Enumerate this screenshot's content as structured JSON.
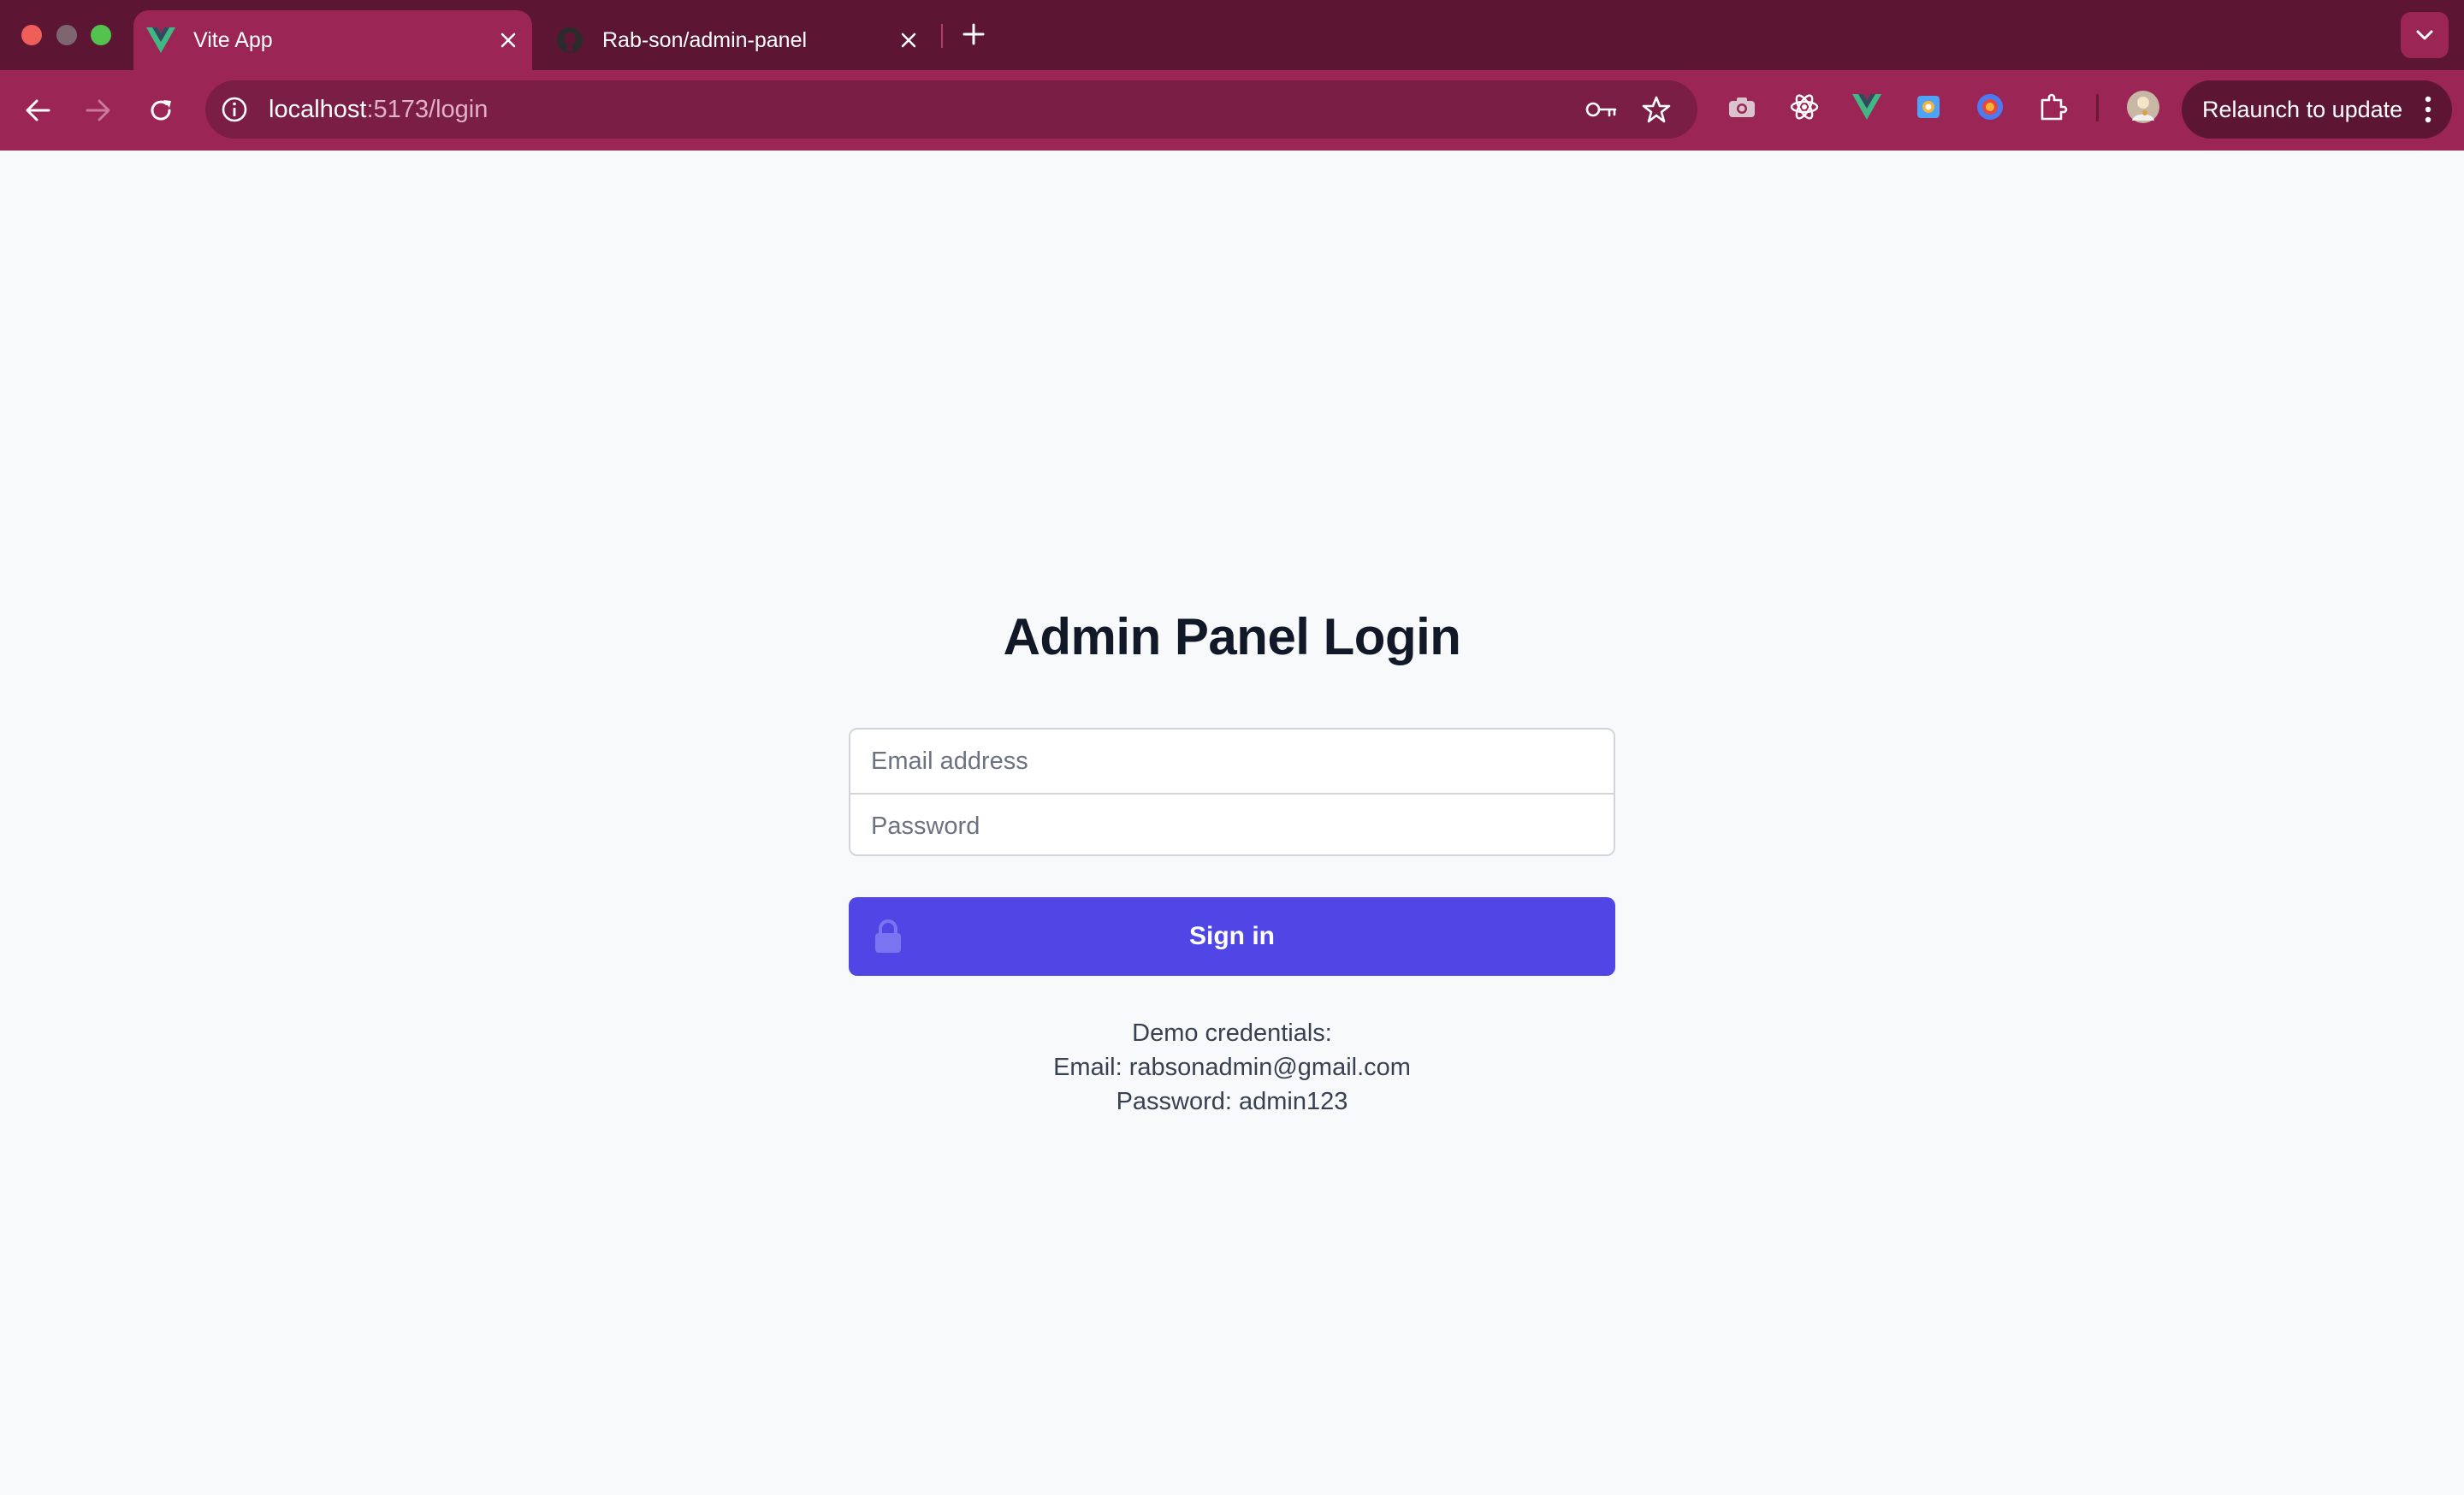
{
  "browser": {
    "tabs": [
      {
        "title": "Vite App",
        "icon": "vue-icon",
        "active": true
      },
      {
        "title": "Rab-son/admin-panel",
        "icon": "github-icon",
        "active": false
      }
    ],
    "url_host": "localhost",
    "url_path": ":5173/login",
    "relaunch_label": "Relaunch to update",
    "colors": {
      "tabbar": "#5c1533",
      "toolbar": "#9b2555"
    }
  },
  "login": {
    "heading": "Admin Panel Login",
    "email_placeholder": "Email address",
    "password_placeholder": "Password",
    "signin_label": "Sign in",
    "demo_title": "Demo credentials:",
    "demo_email": "Email: rabsonadmin@gmail.com",
    "demo_password": "Password: admin123",
    "accent_color": "#4f46e5"
  }
}
